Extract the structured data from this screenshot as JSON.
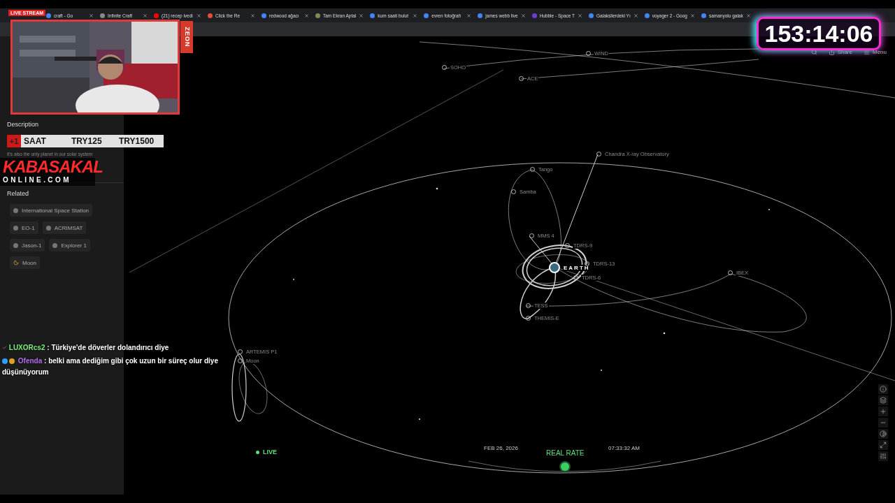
{
  "browser_tabs": [
    {
      "label": "craft - Go",
      "color": "#4285f4"
    },
    {
      "label": "Infinite Craft",
      "color": "#888888"
    },
    {
      "label": "(21) recep ivedi",
      "color": "#ff0000"
    },
    {
      "label": "Click the Re",
      "color": "#e74c3c"
    },
    {
      "label": "redwood ağacı",
      "color": "#4285f4"
    },
    {
      "label": "Tam Ekran Aptal",
      "color": "#7a8a5a"
    },
    {
      "label": "kum saati bulut",
      "color": "#4285f4"
    },
    {
      "label": "evren fotoğrafı",
      "color": "#4285f4"
    },
    {
      "label": "james webb live",
      "color": "#4285f4"
    },
    {
      "label": "Hubble - Space T",
      "color": "#6a3fd0"
    },
    {
      "label": "Galaksilerdeki Yı",
      "color": "#4285f4"
    },
    {
      "label": "voyager 2 - Goog",
      "color": "#4285f4"
    },
    {
      "label": "samanyolu galak",
      "color": "#4285f4"
    }
  ],
  "stream_overlay": {
    "live_badge": "LIVE STREAM",
    "webcam_brand": "ZEON",
    "timer": "153:14:06",
    "price_banner": {
      "badge": "+1",
      "items": [
        "SAAT",
        "TRY125",
        "TRY1500"
      ]
    },
    "logo": {
      "title": "KABASAKAL",
      "subtitle": "ONLINE.COM"
    },
    "chat": [
      {
        "user": "LUXORcs2",
        "color": "#7cf07c",
        "separator": ":",
        "text": "Türkiye'de döverler dolandırıcı diye",
        "badges": false
      },
      {
        "user": "Ofenda",
        "color": "#b070f0",
        "separator": ":",
        "text": "belki ama dediğim gibi çok uzun bir süreç olur diye düşünüyorum",
        "badges": true
      }
    ]
  },
  "sidebar": {
    "description_heading": "Description",
    "description_text": "It's also the only planet in our solar system",
    "related_heading": "Related",
    "related": [
      {
        "label": "International Space Station",
        "kind": "spacecraft"
      },
      {
        "label": "EO-1",
        "kind": "spacecraft"
      },
      {
        "label": "ACRIMSAT",
        "kind": "spacecraft"
      },
      {
        "label": "Jason-1",
        "kind": "spacecraft"
      },
      {
        "label": "Explorer 1",
        "kind": "spacecraft"
      },
      {
        "label": "Moon",
        "kind": "moon"
      }
    ]
  },
  "nav": {
    "share": "Share",
    "menu": "Menu"
  },
  "scene": {
    "labels": [
      {
        "name": "SOHO",
        "kind": "spacecraft"
      },
      {
        "name": "WIND",
        "kind": "spacecraft"
      },
      {
        "name": "ACE",
        "kind": "spacecraft"
      },
      {
        "name": "Chandra X-ray Observatory",
        "kind": "spacecraft"
      },
      {
        "name": "Tango",
        "kind": "spacecraft"
      },
      {
        "name": "Samba",
        "kind": "spacecraft"
      },
      {
        "name": "MMS 4",
        "kind": "spacecraft"
      },
      {
        "name": "TDRS-9",
        "kind": "spacecraft"
      },
      {
        "name": "EARTH",
        "kind": "planet"
      },
      {
        "name": "TDRS-13",
        "kind": "spacecraft"
      },
      {
        "name": "TDRS-6",
        "kind": "spacecraft"
      },
      {
        "name": "TESS",
        "kind": "spacecraft"
      },
      {
        "name": "THEMIS-E",
        "kind": "spacecraft"
      },
      {
        "name": "IBEX",
        "kind": "spacecraft"
      },
      {
        "name": "ARTEMIS P1",
        "kind": "spacecraft"
      },
      {
        "name": "Moon",
        "kind": "spacecraft"
      }
    ]
  },
  "time_controls": {
    "live": "LIVE",
    "date": "FEB 26, 2026",
    "rate": "REAL RATE",
    "time": "07:33:32 AM"
  }
}
